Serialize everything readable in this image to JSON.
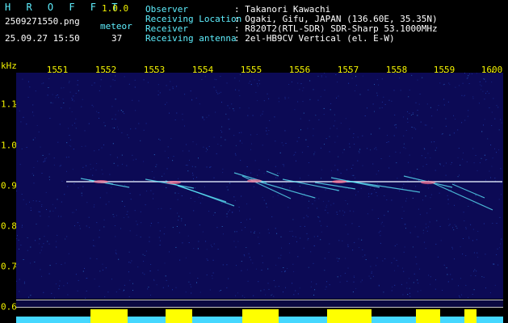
{
  "header": {
    "app_name": "H R O F F T",
    "version": "1.0.0",
    "filename": "2509271550.png",
    "datetime": "25.09.27 15:50",
    "meteor_label": "meteor",
    "meteor_count": "37",
    "fields": [
      {
        "label": "Observer",
        "value": ": Takanori Kawachi"
      },
      {
        "label": "Receiving Location",
        "value": ": Ogaki, Gifu, JAPAN (136.60E, 35.35N)"
      },
      {
        "label": "Receiver",
        "value": ": R820T2(RTL-SDR) SDR-Sharp 53.1000MHz"
      },
      {
        "label": "Receiving antenna",
        "value": ": 2el-HB9CV Vertical (el. E-W)"
      }
    ]
  },
  "axes": {
    "y_unit": "kHz",
    "x_ticks": [
      "1551",
      "1552",
      "1553",
      "1554",
      "1555",
      "1556",
      "1557",
      "1558",
      "1559",
      "1600"
    ],
    "y_ticks": [
      "1.1",
      "1.0",
      "0.9",
      "0.8",
      "0.7",
      "0.6"
    ]
  },
  "colors": {
    "background": "#000000",
    "label": "#5ff0ff",
    "axis": "#f2f200",
    "plot": "#0c0a55",
    "echo": "#5ff0ff",
    "carrier": "#e8f0ff"
  }
}
